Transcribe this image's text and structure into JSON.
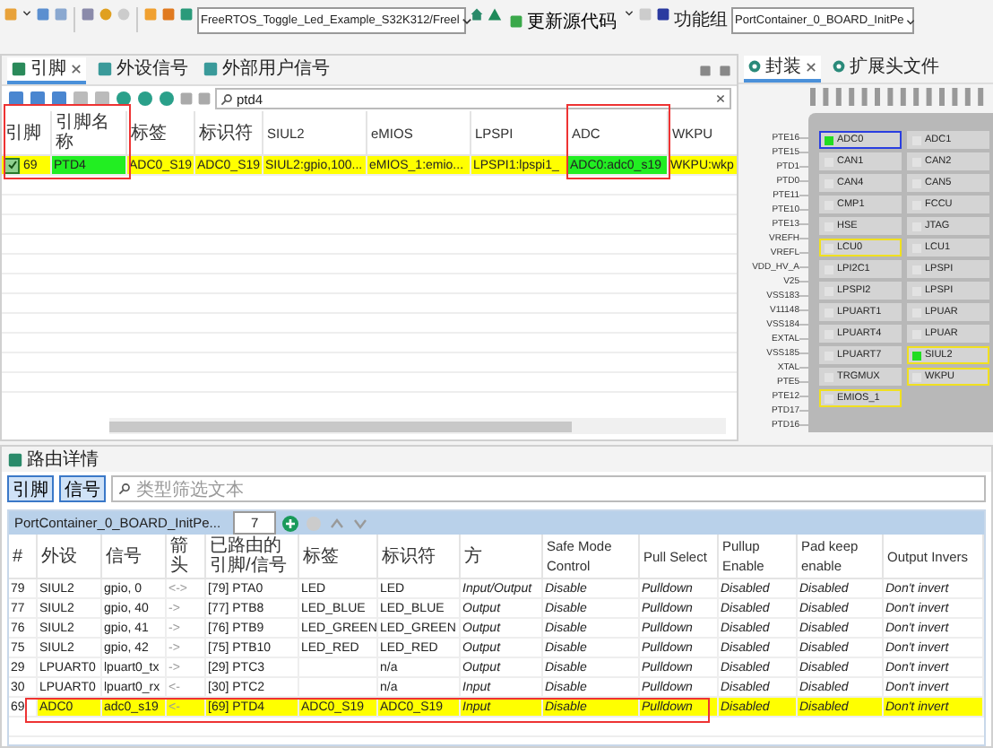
{
  "toolbar": {
    "project": "FreeRTOS_Toggle_Led_Example_S32K312/Freel",
    "update_button": "更新源代码",
    "function_group_label": "功能组",
    "function_group": "PortContainer_0_BOARD_InitPe"
  },
  "pins_panel": {
    "tabs": [
      {
        "label": "引脚",
        "selected": true
      },
      {
        "label": "外设信号",
        "selected": false
      },
      {
        "label": "外部用户信号",
        "selected": false
      }
    ],
    "search": "ptd4",
    "columns": [
      "引脚",
      "引脚名称",
      "标签",
      "标识符",
      "SIUL2",
      "eMIOS",
      "LPSPI",
      "ADC",
      "WKPU"
    ],
    "rows": [
      {
        "checked": true,
        "highlighted": true,
        "cells": [
          {
            "text": "69",
            "matched": false
          },
          {
            "text": "PTD4",
            "matched": true
          },
          {
            "text": "ADC0_S19",
            "matched": false
          },
          {
            "text": "ADC0_S19",
            "matched": false
          },
          {
            "text": "SIUL2:gpio,100...",
            "matched": false
          },
          {
            "text": "eMIOS_1:emio...",
            "matched": false
          },
          {
            "text": "LPSPI1:lpspi1_",
            "matched": false
          },
          {
            "text": "ADC0:adc0_s19",
            "matched": true
          },
          {
            "text": "WKPU:wkp",
            "matched": false
          }
        ]
      }
    ]
  },
  "package_panel": {
    "tabs": [
      {
        "label": "封装",
        "selected": true
      },
      {
        "label": "扩展头文件",
        "selected": false
      }
    ],
    "left_pins": [
      "PTE16",
      "PTE15",
      "PTD1",
      "PTD0",
      "PTE11",
      "PTE10",
      "PTE13",
      "VREFH",
      "VREFL",
      "VDD_HV_A",
      "V25",
      "VSS183",
      "V11148",
      "VSS184",
      "EXTAL",
      "VSS185",
      "XTAL",
      "PTE5",
      "PTE12",
      "PTD17",
      "PTD16"
    ],
    "modules": [
      {
        "name": "ADC0",
        "active": true,
        "kind": "focused"
      },
      {
        "name": "ADC1",
        "active": false,
        "kind": "plain"
      },
      {
        "name": "CAN1",
        "active": false,
        "kind": "plain"
      },
      {
        "name": "CAN2",
        "active": false,
        "kind": "plain"
      },
      {
        "name": "CAN4",
        "active": false,
        "kind": "plain"
      },
      {
        "name": "CAN5",
        "active": false,
        "kind": "plain"
      },
      {
        "name": "CMP1",
        "active": false,
        "kind": "plain"
      },
      {
        "name": "FCCU",
        "active": false,
        "kind": "plain"
      },
      {
        "name": "HSE",
        "active": false,
        "kind": "plain"
      },
      {
        "name": "JTAG",
        "active": false,
        "kind": "plain"
      },
      {
        "name": "LCU0",
        "active": false,
        "kind": "routed"
      },
      {
        "name": "LCU1",
        "active": false,
        "kind": "plain"
      },
      {
        "name": "LPI2C1",
        "active": false,
        "kind": "plain"
      },
      {
        "name": "LPSPI",
        "active": false,
        "kind": "plain"
      },
      {
        "name": "LPSPI2",
        "active": false,
        "kind": "plain"
      },
      {
        "name": "LPSPI",
        "active": false,
        "kind": "plain"
      },
      {
        "name": "LPUART1",
        "active": false,
        "kind": "plain"
      },
      {
        "name": "LPUAR",
        "active": false,
        "kind": "plain"
      },
      {
        "name": "LPUART4",
        "active": false,
        "kind": "plain"
      },
      {
        "name": "LPUAR",
        "active": false,
        "kind": "plain"
      },
      {
        "name": "LPUART7",
        "active": false,
        "kind": "plain"
      },
      {
        "name": "SIUL2",
        "active": true,
        "kind": "routed"
      },
      {
        "name": "TRGMUX",
        "active": false,
        "kind": "plain"
      },
      {
        "name": "WKPU",
        "active": false,
        "kind": "routed"
      },
      {
        "name": "EMIOS_1",
        "active": false,
        "kind": "routed"
      }
    ]
  },
  "routing": {
    "title": "路由详情",
    "filters": [
      {
        "label": "引脚",
        "selected": true
      },
      {
        "label": "信号",
        "selected": true
      }
    ],
    "filter_placeholder": "类型筛选文本",
    "container": "PortContainer_0_BOARD_InitPe...",
    "count": "7",
    "columns": [
      "#",
      "外设",
      "信号",
      "箭头",
      "已路由的引脚/信号",
      "标签",
      "标识符",
      "方",
      "Safe Mode Control",
      "Pull Select",
      "Pullup Enable",
      "Pad keep enable",
      "Output Invers"
    ],
    "rows": [
      {
        "highlighted": false,
        "cells": [
          "79",
          "SIUL2",
          "gpio, 0",
          "<->",
          "[79] PTA0",
          "LED",
          "LED",
          "Input/Output",
          "Disable",
          "Pulldown",
          "Disabled",
          "Disabled",
          "Don't invert"
        ]
      },
      {
        "highlighted": false,
        "cells": [
          "77",
          "SIUL2",
          "gpio, 40",
          "->",
          "[77] PTB8",
          "LED_BLUE",
          "LED_BLUE",
          "Output",
          "Disable",
          "Pulldown",
          "Disabled",
          "Disabled",
          "Don't invert"
        ]
      },
      {
        "highlighted": false,
        "cells": [
          "76",
          "SIUL2",
          "gpio, 41",
          "->",
          "[76] PTB9",
          "LED_GREEN",
          "LED_GREEN",
          "Output",
          "Disable",
          "Pulldown",
          "Disabled",
          "Disabled",
          "Don't invert"
        ]
      },
      {
        "highlighted": false,
        "cells": [
          "75",
          "SIUL2",
          "gpio, 42",
          "->",
          "[75] PTB10",
          "LED_RED",
          "LED_RED",
          "Output",
          "Disable",
          "Pulldown",
          "Disabled",
          "Disabled",
          "Don't invert"
        ]
      },
      {
        "highlighted": false,
        "cells": [
          "29",
          "LPUART0",
          "lpuart0_tx",
          "->",
          "[29] PTC3",
          "",
          "n/a",
          "Output",
          "Disable",
          "Pulldown",
          "Disabled",
          "Disabled",
          "Don't invert"
        ]
      },
      {
        "highlighted": false,
        "cells": [
          "30",
          "LPUART0",
          "lpuart0_rx",
          "<-",
          "[30] PTC2",
          "",
          "n/a",
          "Input",
          "Disable",
          "Pulldown",
          "Disabled",
          "Disabled",
          "Don't invert"
        ]
      },
      {
        "highlighted": true,
        "cells": [
          "69",
          "ADC0",
          "adc0_s19",
          "<-",
          "[69] PTD4",
          "ADC0_S19",
          "ADC0_S19",
          "Input",
          "Disable",
          "Pulldown",
          "Disabled",
          "Disabled",
          "Don't invert"
        ]
      }
    ]
  }
}
